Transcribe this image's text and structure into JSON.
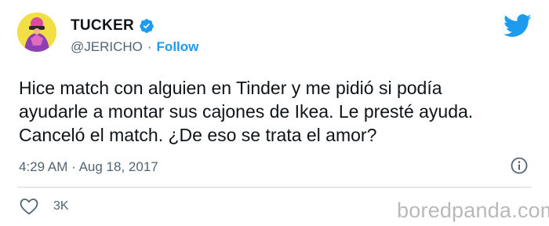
{
  "user": {
    "name": "TUCKER",
    "handle": "@JERICHO",
    "separator": "·",
    "follow_label": "Follow"
  },
  "tweet": {
    "lines": [
      "Hice match con alguien en Tinder y me pidió si podía",
      "ayudarle a montar sus cajones de Ikea. Le presté ayuda.",
      "Canceló el match. ¿De eso se trata el amor?"
    ],
    "time": "4:29 AM",
    "date": "Aug 18, 2017",
    "likes": "3K"
  },
  "icons": {
    "verified": "verified-badge-icon",
    "brand": "twitter-bird-icon",
    "info": "info-icon",
    "like": "heart-icon"
  },
  "colors": {
    "accent": "#1d9bf0",
    "text": "#0f1419",
    "muted": "#536471",
    "divider": "#cfd9de",
    "watermark": "#b9b9b9"
  },
  "watermark": "boredpanda.com"
}
